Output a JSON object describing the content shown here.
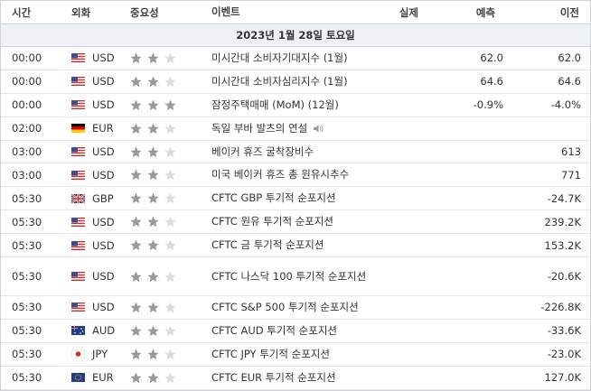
{
  "header": {
    "time": "시간",
    "currency": "외화",
    "importance": "중요성",
    "event": "이벤트",
    "actual": "실제",
    "forecast": "예측",
    "previous": "이전"
  },
  "date_label": "2023년 1월 28일 토요일",
  "colors": {
    "star_on": "#9a9a9a",
    "star_off": "#dcdcdc",
    "date_bg": "#eef1f5",
    "border": "#cfd4da"
  },
  "rows": [
    {
      "time": "00:00",
      "flag": "us-flag-icon",
      "currency": "USD",
      "stars": 2,
      "event": "미시간대 소비자기대지수 (1월)",
      "actual": "",
      "forecast": "62.0",
      "previous": "62.0"
    },
    {
      "time": "00:00",
      "flag": "us-flag-icon",
      "currency": "USD",
      "stars": 2,
      "event": "미시간대 소비자심리지수 (1월)",
      "actual": "",
      "forecast": "64.6",
      "previous": "64.6"
    },
    {
      "time": "00:00",
      "flag": "us-flag-icon",
      "currency": "USD",
      "stars": 3,
      "event": "잠정주택매매 (MoM) (12월)",
      "actual": "",
      "forecast": "-0.9%",
      "previous": "-4.0%"
    },
    {
      "time": "02:00",
      "flag": "de-flag-icon",
      "currency": "EUR",
      "stars": 2,
      "event": "독일 부바 발츠의 연설",
      "speech": true,
      "actual": "",
      "forecast": "",
      "previous": ""
    },
    {
      "time": "03:00",
      "flag": "us-flag-icon",
      "currency": "USD",
      "stars": 2,
      "event": "베이커 휴즈 굴착장비수",
      "actual": "",
      "forecast": "",
      "previous": "613"
    },
    {
      "time": "03:00",
      "flag": "us-flag-icon",
      "currency": "USD",
      "stars": 2,
      "event": "미국 베이커 휴즈 총 원유시추수",
      "actual": "",
      "forecast": "",
      "previous": "771"
    },
    {
      "time": "05:30",
      "flag": "gb-flag-icon",
      "currency": "GBP",
      "stars": 2,
      "event": "CFTC GBP 투기적 순포지션",
      "actual": "",
      "forecast": "",
      "previous": "-24.7K"
    },
    {
      "time": "05:30",
      "flag": "us-flag-icon",
      "currency": "USD",
      "stars": 2,
      "event": "CFTC 원유 투기적 순포지션",
      "actual": "",
      "forecast": "",
      "previous": "239.2K"
    },
    {
      "time": "05:30",
      "flag": "us-flag-icon",
      "currency": "USD",
      "stars": 2,
      "event": "CFTC 금 투기적 순포지션",
      "actual": "",
      "forecast": "",
      "previous": "153.2K"
    },
    {
      "time": "05:30",
      "flag": "us-flag-icon",
      "currency": "USD",
      "stars": 2,
      "event": "CFTC 나스닥 100 투기적 순포지션",
      "actual": "",
      "forecast": "",
      "previous": "-20.6K",
      "tall": true
    },
    {
      "time": "05:30",
      "flag": "us-flag-icon",
      "currency": "USD",
      "stars": 2,
      "event": "CFTC S&P 500 투기적 순포지션",
      "actual": "",
      "forecast": "",
      "previous": "-226.8K"
    },
    {
      "time": "05:30",
      "flag": "au-flag-icon",
      "currency": "AUD",
      "stars": 2,
      "event": "CFTC AUD 투기적 순포지션",
      "actual": "",
      "forecast": "",
      "previous": "-33.6K"
    },
    {
      "time": "05:30",
      "flag": "jp-flag-icon",
      "currency": "JPY",
      "stars": 2,
      "event": "CFTC JPY 투기적 순포지션",
      "actual": "",
      "forecast": "",
      "previous": "-23.0K"
    },
    {
      "time": "05:30",
      "flag": "eu-flag-icon",
      "currency": "EUR",
      "stars": 2,
      "event": "CFTC EUR 투기적 순포지션",
      "actual": "",
      "forecast": "",
      "previous": "127.0K"
    }
  ]
}
